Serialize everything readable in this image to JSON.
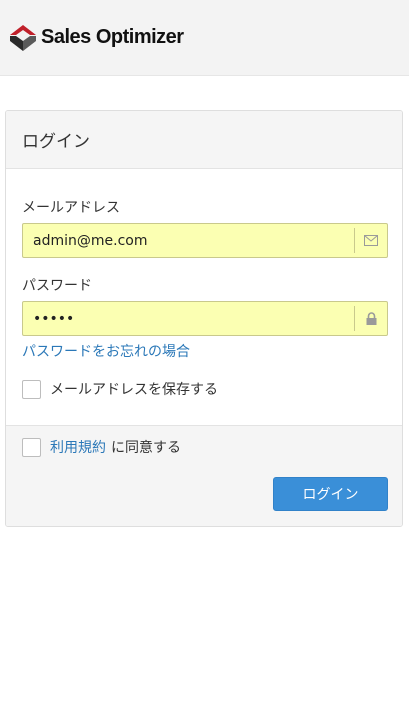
{
  "brand": {
    "name": "Sales Optimizer"
  },
  "login_card": {
    "title": "ログイン",
    "email": {
      "label": "メールアドレス",
      "value": "admin@me.com"
    },
    "password": {
      "label": "パスワード",
      "value": "•••••"
    },
    "forgot_link": "パスワードをお忘れの場合",
    "remember": {
      "label": "メールアドレスを保存する",
      "checked": false
    },
    "terms": {
      "link_text": "利用規約",
      "suffix": "に同意する",
      "checked": false
    },
    "submit_label": "ログイン"
  },
  "icons": {
    "email_addon": "envelope-icon",
    "password_addon": "lock-icon"
  },
  "colors": {
    "accent": "#3a8fd8",
    "link": "#2b78b8",
    "autofill_background": "#fbffb2"
  }
}
